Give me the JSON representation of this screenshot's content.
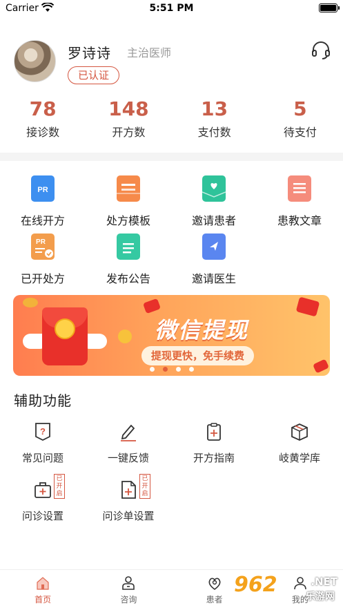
{
  "status_bar": {
    "carrier": "Carrier",
    "time": "5:51 PM"
  },
  "profile": {
    "name": "罗诗诗",
    "title": "主治医师",
    "badge": "已认证"
  },
  "stats": [
    {
      "value": "78",
      "label": "接诊数"
    },
    {
      "value": "148",
      "label": "开方数"
    },
    {
      "value": "13",
      "label": "支付数"
    },
    {
      "value": "5",
      "label": "待支付"
    }
  ],
  "functions": [
    {
      "label": "在线开方",
      "icon": "prescription-icon",
      "color": "#3d8ff0"
    },
    {
      "label": "处方模板",
      "icon": "template-icon",
      "color": "#f68a4a"
    },
    {
      "label": "邀请患者",
      "icon": "invite-patient-icon",
      "color": "#2fc39a"
    },
    {
      "label": "患教文章",
      "icon": "article-icon",
      "color": "#f58c7c"
    },
    {
      "label": "已开处方",
      "icon": "issued-prescription-icon",
      "color": "#f39d4c"
    },
    {
      "label": "发布公告",
      "icon": "announcement-icon",
      "color": "#35c9a2"
    },
    {
      "label": "邀请医生",
      "icon": "invite-doctor-icon",
      "color": "#5a86f0"
    }
  ],
  "banner": {
    "title": "微信提现",
    "subtitle": "提现更快，免手续费",
    "active_slide": 2,
    "slide_count": 4
  },
  "aux": {
    "title": "辅助功能",
    "items": [
      {
        "label": "常见问题",
        "icon": "question-icon"
      },
      {
        "label": "一键反馈",
        "icon": "pen-icon"
      },
      {
        "label": "开方指南",
        "icon": "clipboard-icon"
      },
      {
        "label": "岐黄学库",
        "icon": "box-icon"
      },
      {
        "label": "问诊设置",
        "icon": "medical-kit-icon",
        "stamp": "已开启"
      },
      {
        "label": "问诊单设置",
        "icon": "document-add-icon",
        "stamp": "已开启"
      }
    ]
  },
  "tabs": [
    {
      "label": "首页",
      "icon": "home-icon"
    },
    {
      "label": "咨询",
      "icon": "consult-icon"
    },
    {
      "label": "患者",
      "icon": "patient-icon"
    },
    {
      "label": "我的",
      "icon": "profile-icon"
    }
  ],
  "colors": {
    "accent": "#d4553f",
    "stat_number": "#c95f4a"
  },
  "watermark": {
    "brand": "962",
    "net": ".NET",
    "text": "乐游网"
  }
}
